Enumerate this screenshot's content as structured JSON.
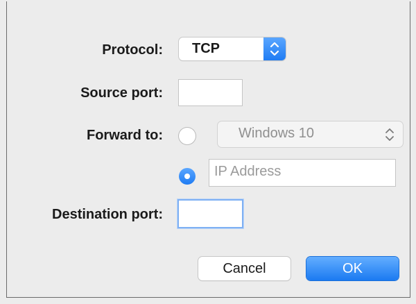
{
  "form": {
    "protocol_label": "Protocol:",
    "protocol_value": "TCP",
    "source_port_label": "Source port:",
    "source_port_value": "",
    "forward_to_label": "Forward to:",
    "forward_machine_value": "Windows 10",
    "forward_machine_selected": false,
    "ip_address_placeholder": "IP Address",
    "ip_address_value": "",
    "ip_address_selected": true,
    "destination_port_label": "Destination port:",
    "destination_port_value": ""
  },
  "buttons": {
    "cancel_label": "Cancel",
    "ok_label": "OK"
  },
  "colors": {
    "accent": "#1f7cf3",
    "background": "#ececec"
  },
  "icons": {
    "protocol_stepper": "up-down-chevron-icon",
    "machine_select_arrows": "up-down-chevron-icon"
  }
}
